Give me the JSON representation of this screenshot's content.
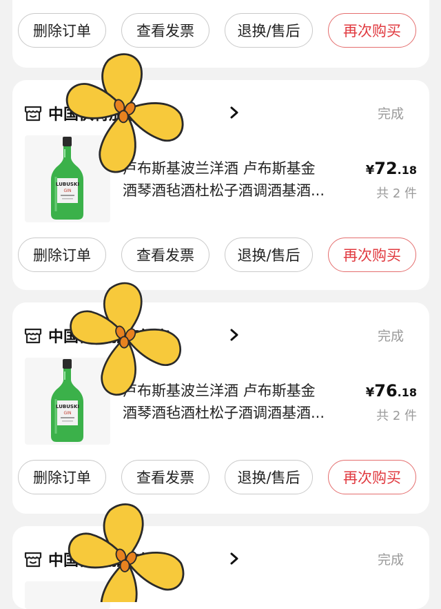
{
  "colors": {
    "accent": "#e0383e",
    "flower": "#f7c93b",
    "bottle": "#2f9e3c"
  },
  "actions": {
    "delete": "删除订单",
    "invoice": "查看发票",
    "returns": "退换/售后",
    "rebuy": "再次购买"
  },
  "orders": [
    {
      "store_name": "中国伏特加旗舰店",
      "status": "完成",
      "title_line1": "卢布斯基波兰洋酒 卢布斯基金",
      "title_line2": "酒琴酒毡酒杜松子酒调酒基酒...",
      "price_symbol": "¥",
      "price_int": "72",
      "price_dec": ".18",
      "count": "共 2 件"
    },
    {
      "store_name": "中国伏特加旗舰店",
      "status": "完成",
      "title_line1": "卢布斯基波兰洋酒 卢布斯基金",
      "title_line2": "酒琴酒毡酒杜松子酒调酒基酒...",
      "price_symbol": "¥",
      "price_int": "76",
      "price_dec": ".18",
      "count": "共 2 件"
    },
    {
      "store_name": "中国伏特加旗舰店",
      "status": "完成"
    }
  ],
  "product_image_label": "LUBUSKI GIN",
  "product_image_text": {
    "brand": "LUBUSKI",
    "variant": "GIN"
  },
  "icons": {
    "store": "store-icon",
    "chevron": "chevron-right-icon",
    "sticker": "flower-sticker-icon"
  }
}
